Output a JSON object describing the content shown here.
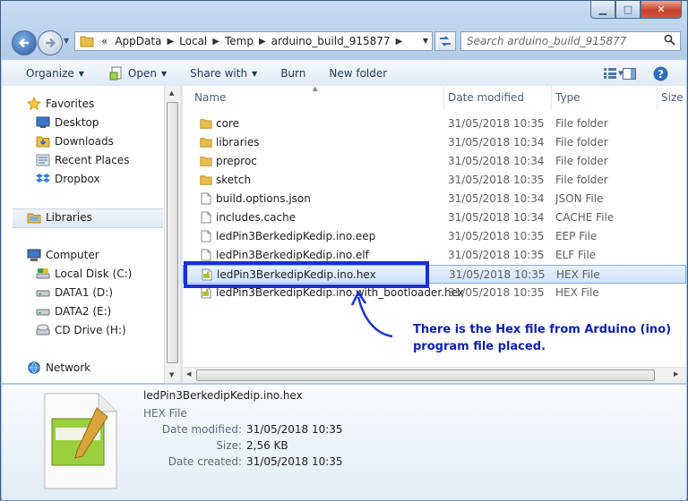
{
  "titlebar": {
    "minimize": "▁",
    "maximize": "□",
    "close": "✕"
  },
  "address": {
    "overflow": "«",
    "crumbs": [
      "AppData",
      "Local",
      "Temp",
      "arduino_build_915877"
    ],
    "separator": "▶"
  },
  "search": {
    "placeholder": "Search arduino_build_915877"
  },
  "toolbar": {
    "organize": "Organize",
    "open": "Open",
    "share_with": "Share with",
    "burn": "Burn",
    "new_folder": "New folder"
  },
  "nav": {
    "favorites": "Favorites",
    "desktop": "Desktop",
    "downloads": "Downloads",
    "recent_places": "Recent Places",
    "dropbox": "Dropbox",
    "libraries": "Libraries",
    "computer": "Computer",
    "local_disk": "Local Disk (C:)",
    "data1": "DATA1 (D:)",
    "data2": "DATA2 (E:)",
    "cd_drive": "CD Drive (H:)",
    "network": "Network"
  },
  "columns": {
    "name": "Name",
    "date_modified": "Date modified",
    "type": "Type",
    "size": "Size"
  },
  "files": [
    {
      "name": "core",
      "date": "31/05/2018 10:35",
      "type": "File folder",
      "kind": "folder"
    },
    {
      "name": "libraries",
      "date": "31/05/2018 10:34",
      "type": "File folder",
      "kind": "folder"
    },
    {
      "name": "preproc",
      "date": "31/05/2018 10:34",
      "type": "File folder",
      "kind": "folder"
    },
    {
      "name": "sketch",
      "date": "31/05/2018 10:35",
      "type": "File folder",
      "kind": "folder"
    },
    {
      "name": "build.options.json",
      "date": "31/05/2018 10:34",
      "type": "JSON File",
      "kind": "file"
    },
    {
      "name": "includes.cache",
      "date": "31/05/2018 10:34",
      "type": "CACHE File",
      "kind": "file"
    },
    {
      "name": "ledPin3BerkedipKedip.ino.eep",
      "date": "31/05/2018 10:35",
      "type": "EEP File",
      "kind": "file"
    },
    {
      "name": "ledPin3BerkedipKedip.ino.elf",
      "date": "31/05/2018 10:35",
      "type": "ELF File",
      "kind": "file"
    },
    {
      "name": "ledPin3BerkedipKedip.ino.hex",
      "date": "31/05/2018 10:35",
      "type": "HEX File",
      "kind": "hex",
      "selected": true
    },
    {
      "name": "ledPin3BerkedipKedip.ino.with_bootloader.hex",
      "date": "31/05/2018 10:35",
      "type": "HEX File",
      "kind": "hex"
    }
  ],
  "annotation": {
    "line1": "There is the Hex file from Arduino (ino)",
    "line2": "program file placed."
  },
  "details": {
    "filename": "ledPin3BerkedipKedip.ino.hex",
    "filetype": "HEX File",
    "date_modified_label": "Date modified:",
    "date_modified": "31/05/2018 10:35",
    "size_label": "Size:",
    "size": "2,56 KB",
    "date_created_label": "Date created:",
    "date_created": "31/05/2018 10:35"
  },
  "colors": {
    "highlight_box": "#1a2fd6",
    "annotation_text": "#0b1fb8",
    "selection_border": "#84acdd"
  }
}
